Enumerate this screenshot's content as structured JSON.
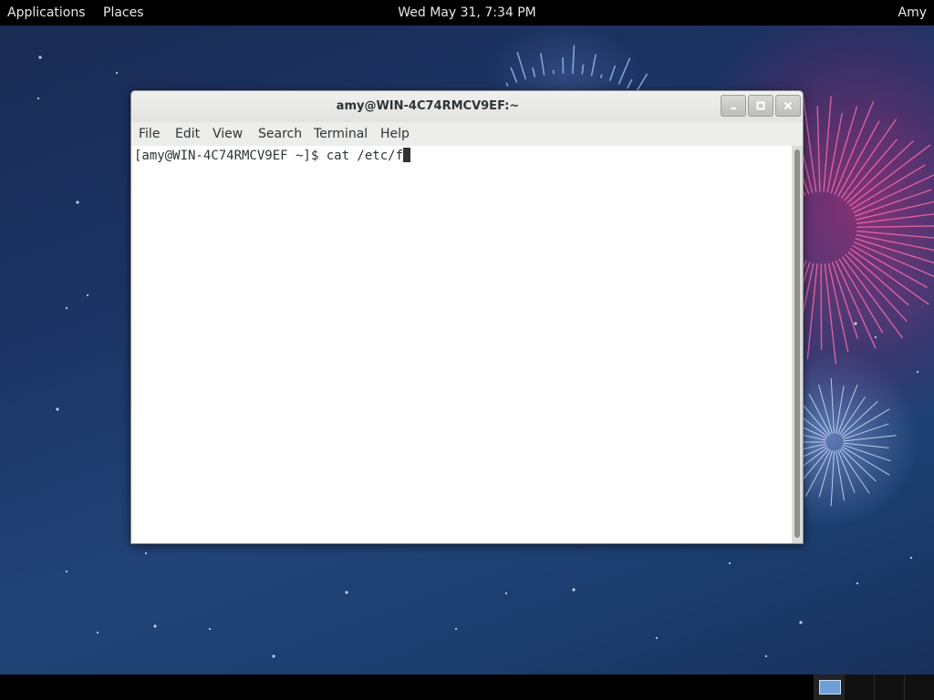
{
  "top_panel": {
    "applications_label": "Applications",
    "places_label": "Places",
    "clock_text": "Wed May 31,  7:34 PM",
    "user_label": "Amy"
  },
  "window": {
    "title": "amy@WIN-4C74RMCV9EF:~",
    "menu": [
      "File",
      "Edit",
      "View",
      "Search",
      "Terminal",
      "Help"
    ],
    "controls": [
      "minimize-icon",
      "maximize-icon",
      "close-icon"
    ]
  },
  "terminal": {
    "prompt": "[amy@WIN-4C74RMCV9EF ~]$ ",
    "command": "cat /etc/f"
  },
  "workspaces": {
    "count": 4,
    "active_index": 0
  },
  "colors": {
    "panel_bg": "#000000",
    "terminal_bg": "#ffffff",
    "terminal_fg": "#2e3436",
    "window_chrome": "#ededeb",
    "workspace_active": "#6fa0d8"
  }
}
